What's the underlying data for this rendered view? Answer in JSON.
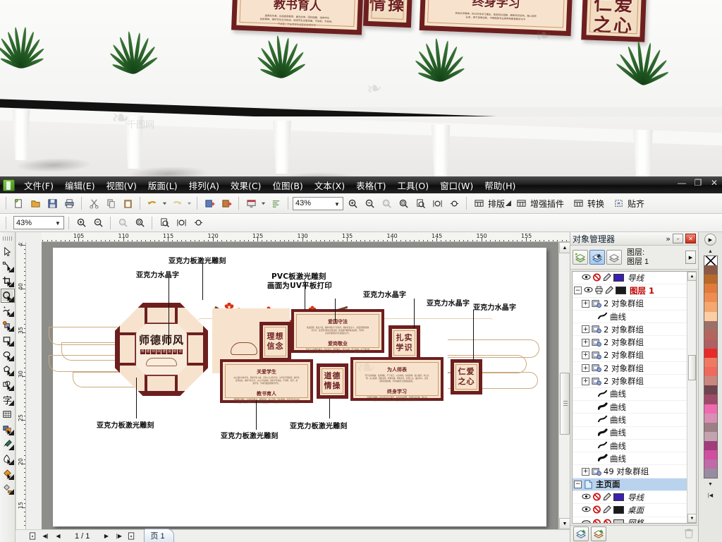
{
  "app": {
    "window_title": "",
    "menus": [
      {
        "label": "文件(F)"
      },
      {
        "label": "编辑(E)"
      },
      {
        "label": "视图(V)"
      },
      {
        "label": "版面(L)"
      },
      {
        "label": "排列(A)"
      },
      {
        "label": "效果(C)"
      },
      {
        "label": "位图(B)"
      },
      {
        "label": "文本(X)"
      },
      {
        "label": "表格(T)"
      },
      {
        "label": "工具(O)"
      },
      {
        "label": "窗口(W)"
      },
      {
        "label": "帮助(H)"
      }
    ],
    "window_controls": {
      "minimize": "—",
      "restore": "❐",
      "close": "✕"
    }
  },
  "toolbar": {
    "zoom_value": "43%",
    "plugin_buttons": [
      {
        "label": "排版",
        "icon": "table-icon"
      },
      {
        "label": "增强插件",
        "icon": "table-icon"
      },
      {
        "label": "转换",
        "icon": "table-icon"
      },
      {
        "label": "贴齐",
        "icon": "snap-icon"
      }
    ],
    "icons": [
      "new-document-icon",
      "open-folder-icon",
      "save-icon",
      "print-icon",
      "cut-scissors-icon",
      "copy-icon",
      "paste-icon",
      "undo-icon",
      "redo-icon",
      "import-icon",
      "export-icon",
      "publish-pdf-icon",
      "application-launcher-icon"
    ]
  },
  "zoom_toolbar": {
    "zoom_value": "43%",
    "icons": [
      "zoom-in-icon",
      "zoom-out-icon",
      "zoom-to-selection-icon",
      "zoom-to-all-objects-icon",
      "zoom-to-page-icon",
      "zoom-to-page-width-icon",
      "zoom-to-page-height-icon"
    ]
  },
  "toolbox": [
    {
      "name": "pick-tool",
      "selected": false
    },
    {
      "name": "shape-tool",
      "selected": false
    },
    {
      "name": "crop-tool",
      "selected": false
    },
    {
      "name": "zoom-tool",
      "selected": true
    },
    {
      "name": "freehand-tool",
      "selected": false
    },
    {
      "name": "smart-fill-tool",
      "selected": false
    },
    {
      "name": "rectangle-tool",
      "selected": false
    },
    {
      "name": "ellipse-tool",
      "selected": false
    },
    {
      "name": "polygon-tool",
      "selected": false
    },
    {
      "name": "basic-shapes-tool",
      "selected": false
    },
    {
      "name": "text-tool",
      "selected": false
    },
    {
      "name": "table-tool",
      "selected": false
    },
    {
      "name": "blend-tool",
      "selected": false
    },
    {
      "name": "eyedropper-tool",
      "selected": false
    },
    {
      "name": "outline-tool",
      "selected": false
    },
    {
      "name": "fill-tool",
      "selected": false
    },
    {
      "name": "interactive-fill-tool",
      "selected": false
    }
  ],
  "rulers": {
    "horizontal_units": [
      "105",
      "110",
      "115",
      "120",
      "125",
      "130",
      "135",
      "140",
      "145",
      "150",
      "155"
    ],
    "vertical_units": [
      "45",
      "40",
      "35",
      "30",
      "25",
      "20",
      "15"
    ]
  },
  "status_bar": {
    "page_indicator": "1 / 1",
    "page_tab": "页 1",
    "nav_icons": [
      "add-page-before-icon",
      "first-page-icon",
      "previous-page-icon",
      "next-page-icon",
      "last-page-icon",
      "add-page-after-icon"
    ]
  },
  "docker": {
    "title": "对象管理器",
    "collapse_icon": "»",
    "minimize_icon": "–",
    "close_icon": "✕",
    "layer_caption_line1": "图层:",
    "layer_caption_line2": "图层 1",
    "view_buttons": [
      {
        "name": "show-object-properties",
        "active": false
      },
      {
        "name": "edit-across-layers",
        "active": true
      },
      {
        "name": "layer-manager-view",
        "active": false
      }
    ],
    "options_button": "▶",
    "tree": [
      {
        "indent": 2,
        "expander": "",
        "eye": true,
        "print": "no-print",
        "edit": true,
        "swatch": "#3a1fb0",
        "label": "导线",
        "italic": true,
        "selected": false
      },
      {
        "indent": 1,
        "expander": "−",
        "eye": true,
        "print": "print",
        "edit": true,
        "swatch": "#1a1a1a",
        "label": "图层 1",
        "red": true,
        "selected": false
      },
      {
        "indent": 2,
        "expander": "+",
        "icon": "group-icon",
        "label": "2 对象群组",
        "selected": false
      },
      {
        "indent": 3,
        "icon": "curve-icon",
        "label": "曲线",
        "selected": false
      },
      {
        "indent": 2,
        "expander": "+",
        "icon": "group-icon",
        "label": "2 对象群组",
        "selected": false
      },
      {
        "indent": 2,
        "expander": "+",
        "icon": "group-icon",
        "label": "2 对象群组",
        "selected": false
      },
      {
        "indent": 2,
        "expander": "+",
        "icon": "group-icon",
        "label": "2 对象群组",
        "selected": false
      },
      {
        "indent": 2,
        "expander": "+",
        "icon": "group-icon",
        "label": "2 对象群组",
        "selected": false
      },
      {
        "indent": 2,
        "expander": "+",
        "icon": "group-icon",
        "label": "2 对象群组",
        "selected": false
      },
      {
        "indent": 3,
        "icon": "curve-icon",
        "label": "曲线",
        "selected": false
      },
      {
        "indent": 3,
        "icon": "curve-filled-icon",
        "label": "曲线",
        "selected": false
      },
      {
        "indent": 3,
        "icon": "curve-icon",
        "label": "曲线",
        "selected": false
      },
      {
        "indent": 3,
        "icon": "curve-filled-icon",
        "label": "曲线",
        "selected": false
      },
      {
        "indent": 3,
        "icon": "curve-icon",
        "label": "曲线",
        "selected": false
      },
      {
        "indent": 3,
        "icon": "curve-filled-icon",
        "label": "曲线",
        "selected": false
      },
      {
        "indent": 2,
        "expander": "+",
        "icon": "group-icon",
        "label": "49 对象群组",
        "selected": false
      },
      {
        "indent": 1,
        "expander": "−",
        "icon": "master-page-icon",
        "label": "主页面",
        "selected": true
      },
      {
        "indent": 2,
        "eye": true,
        "print": "no-print",
        "edit": true,
        "swatch": "#3a1fb0",
        "label": "导线",
        "italic": true,
        "selected": false
      },
      {
        "indent": 2,
        "eye": true,
        "print": "no-print",
        "edit": true,
        "swatch": "#1a1a1a",
        "label": "桌面",
        "italic": true,
        "selected": false
      },
      {
        "indent": 2,
        "eye": "half",
        "print": "no-print",
        "edit": "no-edit",
        "swatch": "#cfcfcf",
        "label": "网格",
        "italic": true,
        "selected": false
      }
    ],
    "footer_buttons": [
      {
        "name": "new-layer-button"
      },
      {
        "name": "new-master-layer-button"
      },
      {
        "name": "delete-button"
      }
    ]
  },
  "palette": {
    "nav_icon": "▶",
    "up_arrow": "▲",
    "down_arrow": "▼",
    "bottom_icon": "|◀",
    "colors": [
      "#ffffff",
      "#8a5a46",
      "#b96a2a",
      "#e07b3c",
      "#ef8c52",
      "#f5a76f",
      "#fbcfa3",
      "#9e7168",
      "#b5665c",
      "#b05f62",
      "#e82a2a",
      "#ee7a62",
      "#ef6a5c",
      "#c9877f",
      "#6f4450",
      "#a04a6a",
      "#f06ab0",
      "#d98fb4",
      "#9d7f86",
      "#c3a3af",
      "#a23c7c",
      "#d04fa0",
      "#c06aa8",
      "#9a8ca0"
    ]
  },
  "artwork": {
    "center_title": "师德师风",
    "center_subtitle_chars": [
      "师",
      "德",
      "师",
      "风",
      "建",
      "设",
      "标",
      "语"
    ],
    "callouts": [
      {
        "id": "c1",
        "text": "亚克力水晶字"
      },
      {
        "id": "c2",
        "text": "亚克力板激光雕刻"
      },
      {
        "id": "c3",
        "text": "PVC板激光雕刻"
      },
      {
        "id": "c4",
        "text": "画面为UV平板打印"
      },
      {
        "id": "c5",
        "text": "亚克力水晶字"
      },
      {
        "id": "c6",
        "text": "亚克力水晶字"
      },
      {
        "id": "c7",
        "text": "亚克力水晶字"
      },
      {
        "id": "c8",
        "text": "亚克力板激光雕刻"
      },
      {
        "id": "c9",
        "text": "亚克力板激光雕刻"
      },
      {
        "id": "c10",
        "text": "亚克力板激光雕刻"
      }
    ],
    "panels": [
      {
        "id": "p1",
        "type": "square",
        "text": "理想\n信念"
      },
      {
        "id": "p2",
        "type": "wide",
        "titles": [
          "爱国守法",
          "爱岗敬业"
        ]
      },
      {
        "id": "p3",
        "type": "square",
        "text": "扎实\n学识"
      },
      {
        "id": "p4",
        "type": "wide",
        "titles": [
          "关爱学生",
          "教书育人"
        ]
      },
      {
        "id": "p5",
        "type": "square",
        "text": "道德\n情操"
      },
      {
        "id": "p6",
        "type": "wide",
        "titles": [
          "为人师表",
          "终身学习"
        ]
      },
      {
        "id": "p7",
        "type": "square",
        "text": "仁爱\n之心"
      }
    ]
  },
  "photo": {
    "boards": [
      {
        "id": "b1",
        "title": "教书育人",
        "kind": "wide"
      },
      {
        "id": "b2",
        "title": "情操",
        "kind": "square"
      },
      {
        "id": "b3",
        "title": "终身学习",
        "kind": "wide"
      },
      {
        "id": "b4",
        "title": "仁爱\n之心",
        "kind": "square"
      }
    ],
    "watermark": "千图网",
    "plants_count": 5
  }
}
